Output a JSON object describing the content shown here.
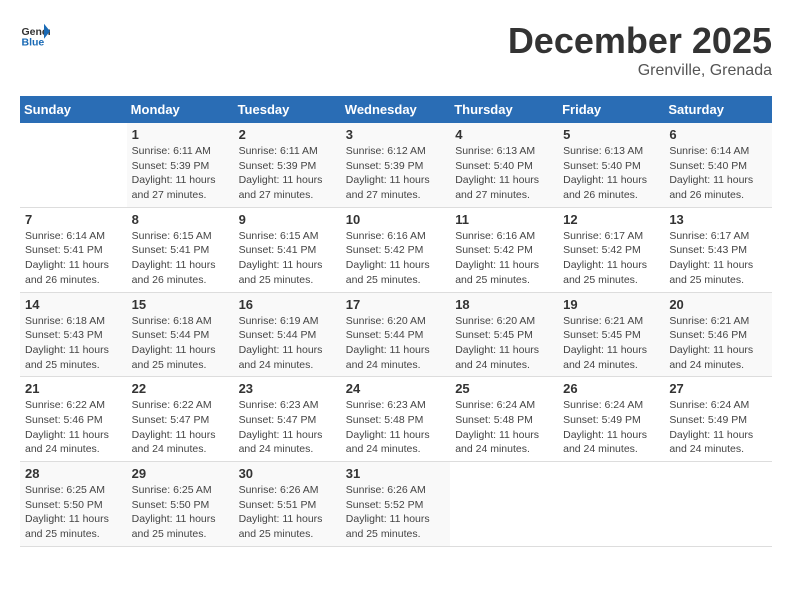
{
  "header": {
    "logo_general": "General",
    "logo_blue": "Blue",
    "title": "December 2025",
    "location": "Grenville, Grenada"
  },
  "weekdays": [
    "Sunday",
    "Monday",
    "Tuesday",
    "Wednesday",
    "Thursday",
    "Friday",
    "Saturday"
  ],
  "weeks": [
    [
      {
        "day": "",
        "sunrise": "",
        "sunset": "",
        "daylight": ""
      },
      {
        "day": "1",
        "sunrise": "Sunrise: 6:11 AM",
        "sunset": "Sunset: 5:39 PM",
        "daylight": "Daylight: 11 hours and 27 minutes."
      },
      {
        "day": "2",
        "sunrise": "Sunrise: 6:11 AM",
        "sunset": "Sunset: 5:39 PM",
        "daylight": "Daylight: 11 hours and 27 minutes."
      },
      {
        "day": "3",
        "sunrise": "Sunrise: 6:12 AM",
        "sunset": "Sunset: 5:39 PM",
        "daylight": "Daylight: 11 hours and 27 minutes."
      },
      {
        "day": "4",
        "sunrise": "Sunrise: 6:13 AM",
        "sunset": "Sunset: 5:40 PM",
        "daylight": "Daylight: 11 hours and 27 minutes."
      },
      {
        "day": "5",
        "sunrise": "Sunrise: 6:13 AM",
        "sunset": "Sunset: 5:40 PM",
        "daylight": "Daylight: 11 hours and 26 minutes."
      },
      {
        "day": "6",
        "sunrise": "Sunrise: 6:14 AM",
        "sunset": "Sunset: 5:40 PM",
        "daylight": "Daylight: 11 hours and 26 minutes."
      }
    ],
    [
      {
        "day": "7",
        "sunrise": "Sunrise: 6:14 AM",
        "sunset": "Sunset: 5:41 PM",
        "daylight": "Daylight: 11 hours and 26 minutes."
      },
      {
        "day": "8",
        "sunrise": "Sunrise: 6:15 AM",
        "sunset": "Sunset: 5:41 PM",
        "daylight": "Daylight: 11 hours and 26 minutes."
      },
      {
        "day": "9",
        "sunrise": "Sunrise: 6:15 AM",
        "sunset": "Sunset: 5:41 PM",
        "daylight": "Daylight: 11 hours and 25 minutes."
      },
      {
        "day": "10",
        "sunrise": "Sunrise: 6:16 AM",
        "sunset": "Sunset: 5:42 PM",
        "daylight": "Daylight: 11 hours and 25 minutes."
      },
      {
        "day": "11",
        "sunrise": "Sunrise: 6:16 AM",
        "sunset": "Sunset: 5:42 PM",
        "daylight": "Daylight: 11 hours and 25 minutes."
      },
      {
        "day": "12",
        "sunrise": "Sunrise: 6:17 AM",
        "sunset": "Sunset: 5:42 PM",
        "daylight": "Daylight: 11 hours and 25 minutes."
      },
      {
        "day": "13",
        "sunrise": "Sunrise: 6:17 AM",
        "sunset": "Sunset: 5:43 PM",
        "daylight": "Daylight: 11 hours and 25 minutes."
      }
    ],
    [
      {
        "day": "14",
        "sunrise": "Sunrise: 6:18 AM",
        "sunset": "Sunset: 5:43 PM",
        "daylight": "Daylight: 11 hours and 25 minutes."
      },
      {
        "day": "15",
        "sunrise": "Sunrise: 6:18 AM",
        "sunset": "Sunset: 5:44 PM",
        "daylight": "Daylight: 11 hours and 25 minutes."
      },
      {
        "day": "16",
        "sunrise": "Sunrise: 6:19 AM",
        "sunset": "Sunset: 5:44 PM",
        "daylight": "Daylight: 11 hours and 24 minutes."
      },
      {
        "day": "17",
        "sunrise": "Sunrise: 6:20 AM",
        "sunset": "Sunset: 5:44 PM",
        "daylight": "Daylight: 11 hours and 24 minutes."
      },
      {
        "day": "18",
        "sunrise": "Sunrise: 6:20 AM",
        "sunset": "Sunset: 5:45 PM",
        "daylight": "Daylight: 11 hours and 24 minutes."
      },
      {
        "day": "19",
        "sunrise": "Sunrise: 6:21 AM",
        "sunset": "Sunset: 5:45 PM",
        "daylight": "Daylight: 11 hours and 24 minutes."
      },
      {
        "day": "20",
        "sunrise": "Sunrise: 6:21 AM",
        "sunset": "Sunset: 5:46 PM",
        "daylight": "Daylight: 11 hours and 24 minutes."
      }
    ],
    [
      {
        "day": "21",
        "sunrise": "Sunrise: 6:22 AM",
        "sunset": "Sunset: 5:46 PM",
        "daylight": "Daylight: 11 hours and 24 minutes."
      },
      {
        "day": "22",
        "sunrise": "Sunrise: 6:22 AM",
        "sunset": "Sunset: 5:47 PM",
        "daylight": "Daylight: 11 hours and 24 minutes."
      },
      {
        "day": "23",
        "sunrise": "Sunrise: 6:23 AM",
        "sunset": "Sunset: 5:47 PM",
        "daylight": "Daylight: 11 hours and 24 minutes."
      },
      {
        "day": "24",
        "sunrise": "Sunrise: 6:23 AM",
        "sunset": "Sunset: 5:48 PM",
        "daylight": "Daylight: 11 hours and 24 minutes."
      },
      {
        "day": "25",
        "sunrise": "Sunrise: 6:24 AM",
        "sunset": "Sunset: 5:48 PM",
        "daylight": "Daylight: 11 hours and 24 minutes."
      },
      {
        "day": "26",
        "sunrise": "Sunrise: 6:24 AM",
        "sunset": "Sunset: 5:49 PM",
        "daylight": "Daylight: 11 hours and 24 minutes."
      },
      {
        "day": "27",
        "sunrise": "Sunrise: 6:24 AM",
        "sunset": "Sunset: 5:49 PM",
        "daylight": "Daylight: 11 hours and 24 minutes."
      }
    ],
    [
      {
        "day": "28",
        "sunrise": "Sunrise: 6:25 AM",
        "sunset": "Sunset: 5:50 PM",
        "daylight": "Daylight: 11 hours and 25 minutes."
      },
      {
        "day": "29",
        "sunrise": "Sunrise: 6:25 AM",
        "sunset": "Sunset: 5:50 PM",
        "daylight": "Daylight: 11 hours and 25 minutes."
      },
      {
        "day": "30",
        "sunrise": "Sunrise: 6:26 AM",
        "sunset": "Sunset: 5:51 PM",
        "daylight": "Daylight: 11 hours and 25 minutes."
      },
      {
        "day": "31",
        "sunrise": "Sunrise: 6:26 AM",
        "sunset": "Sunset: 5:52 PM",
        "daylight": "Daylight: 11 hours and 25 minutes."
      },
      {
        "day": "",
        "sunrise": "",
        "sunset": "",
        "daylight": ""
      },
      {
        "day": "",
        "sunrise": "",
        "sunset": "",
        "daylight": ""
      },
      {
        "day": "",
        "sunrise": "",
        "sunset": "",
        "daylight": ""
      }
    ]
  ]
}
